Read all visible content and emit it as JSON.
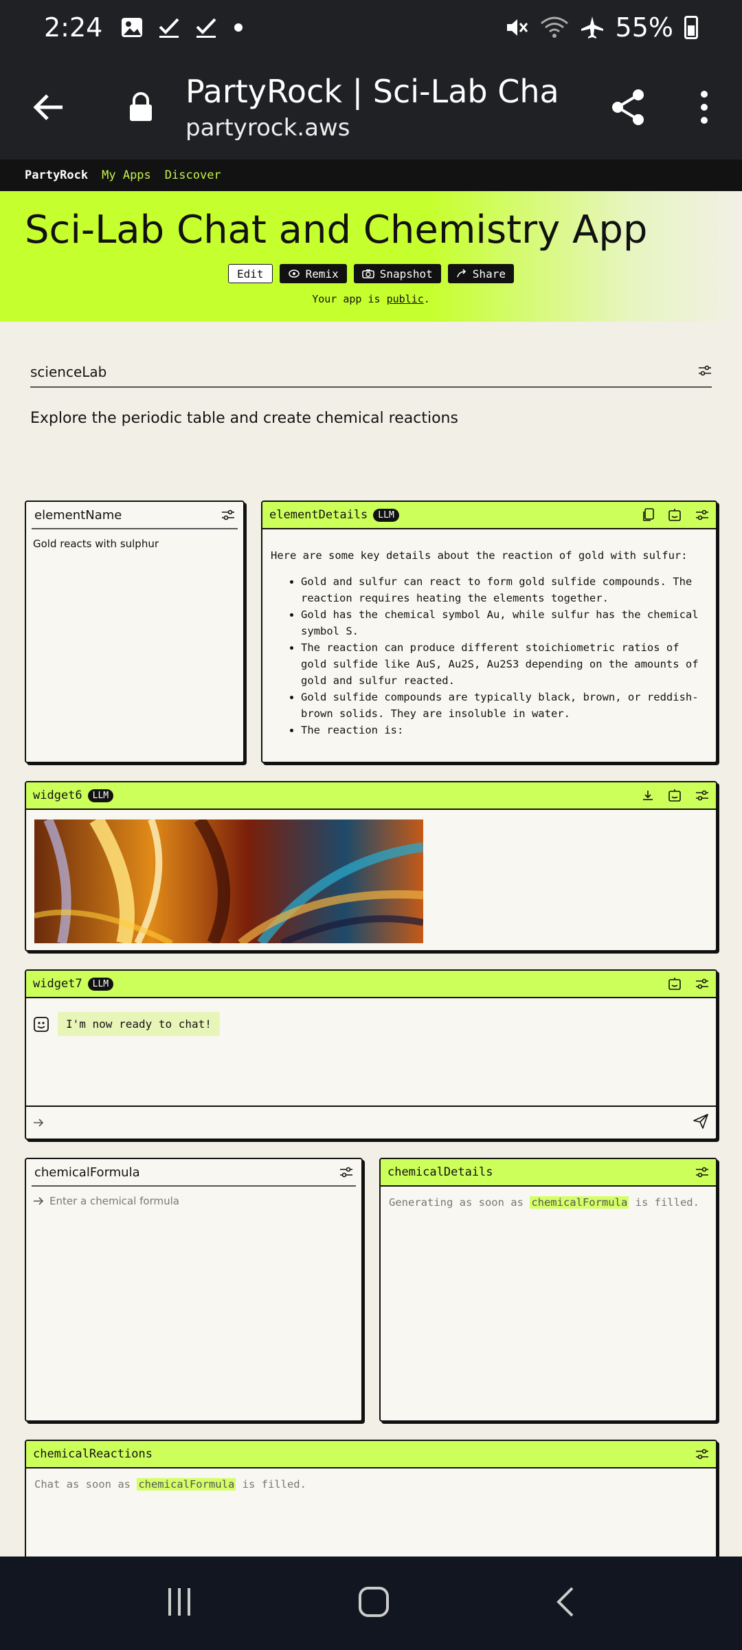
{
  "status": {
    "time": "2:24",
    "battery": "55%"
  },
  "browser": {
    "title": "PartyRock | Sci-Lab Chat ...",
    "url": "partyrock.aws"
  },
  "nav": {
    "brand": "PartyRock",
    "links": [
      "My Apps",
      "Discover"
    ]
  },
  "hero": {
    "title": "Sci-Lab Chat and Chemistry App",
    "buttons": {
      "edit": "Edit",
      "remix": "Remix",
      "snapshot": "Snapshot",
      "share": "Share"
    },
    "public_prefix": "Your app is ",
    "public_link": "public",
    "public_suffix": "."
  },
  "app": {
    "name_field": "scienceLab",
    "description": "Explore the periodic table and create chemical reactions"
  },
  "widgets": {
    "elementName": {
      "title": "elementName",
      "value": "Gold reacts with sulphur"
    },
    "elementDetails": {
      "title": "elementDetails",
      "badge": "LLM",
      "intro": "Here are some key details about the reaction of gold with sulfur:",
      "bullets": [
        "Gold and sulfur can react to form gold sulfide compounds. The reaction requires heating the elements together.",
        "Gold has the chemical symbol Au, while sulfur has the chemical symbol S.",
        "The reaction can produce different stoichiometric ratios of gold sulfide like AuS, Au2S, Au2S3 depending on the amounts of gold and sulfur reacted.",
        "Gold sulfide compounds are typically black, brown, or reddish-brown solids. They are insoluble in water.",
        "The reaction is:"
      ]
    },
    "widget6": {
      "title": "widget6",
      "badge": "LLM"
    },
    "widget7": {
      "title": "widget7",
      "badge": "LLM",
      "message": "I'm now ready to chat!"
    },
    "chemicalFormula": {
      "title": "chemicalFormula",
      "placeholder": "Enter a chemical formula"
    },
    "chemicalDetails": {
      "title": "chemicalDetails",
      "prefix": "Generating as soon as ",
      "ref": "chemicalFormula",
      "suffix": " is filled."
    },
    "chemicalReactions": {
      "title": "chemicalReactions",
      "prefix": "Chat as soon as ",
      "ref": "chemicalFormula",
      "suffix": " is filled."
    }
  }
}
